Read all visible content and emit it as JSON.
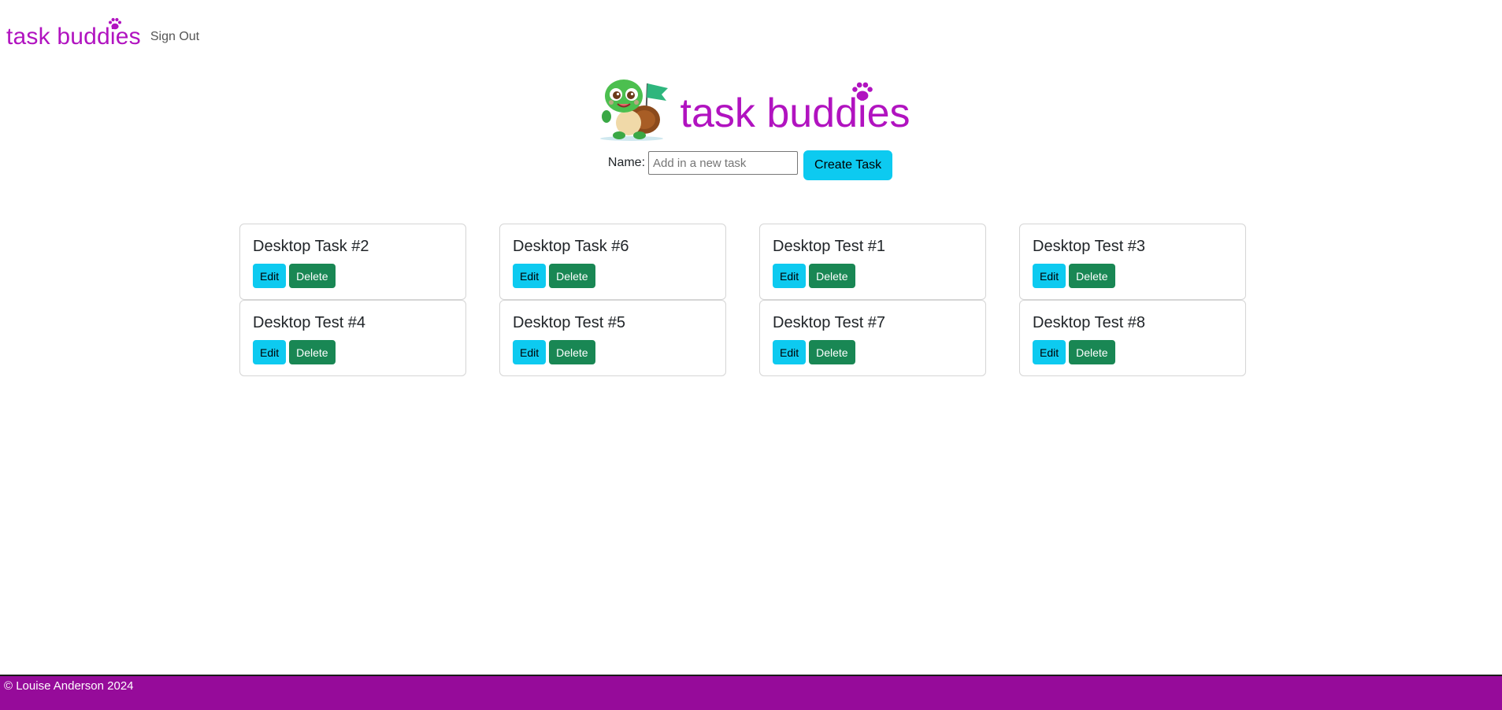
{
  "navbar": {
    "brand": "task buddies",
    "brand_icon": "paw-icon",
    "sign_out": "Sign Out"
  },
  "hero": {
    "title": "task buddies",
    "mascot": "turtle-mascot",
    "title_icon": "paw-icon"
  },
  "form": {
    "name_label": "Name:",
    "input_value": "",
    "input_placeholder": "Add in a new task",
    "create_label": "Create Task"
  },
  "tasks": [
    {
      "title": "Desktop Task #2",
      "edit": "Edit",
      "delete": "Delete"
    },
    {
      "title": "Desktop Task #6",
      "edit": "Edit",
      "delete": "Delete"
    },
    {
      "title": "Desktop Test #1",
      "edit": "Edit",
      "delete": "Delete"
    },
    {
      "title": "Desktop Test #3",
      "edit": "Edit",
      "delete": "Delete"
    },
    {
      "title": "Desktop Test #4",
      "edit": "Edit",
      "delete": "Delete"
    },
    {
      "title": "Desktop Test #5",
      "edit": "Edit",
      "delete": "Delete"
    },
    {
      "title": "Desktop Test #7",
      "edit": "Edit",
      "delete": "Delete"
    },
    {
      "title": "Desktop Test #8",
      "edit": "Edit",
      "delete": "Delete"
    }
  ],
  "footer": {
    "copyright": "© Louise Anderson 2024"
  },
  "colors": {
    "brand": "#b113c0",
    "footer_bg": "#960b9a",
    "edit_button": "#0dcaf0",
    "delete_button": "#198754"
  }
}
